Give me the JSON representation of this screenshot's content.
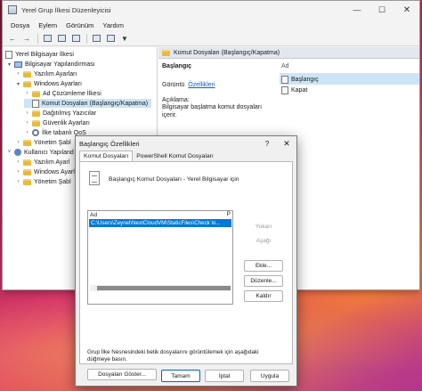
{
  "window": {
    "title": "Yerel Grup İlkesi Düzenleyicisi",
    "controls": {
      "minimize": "—",
      "maximize": "☐",
      "close": "✕"
    }
  },
  "menu": [
    "Dosya",
    "Eylem",
    "Görünüm",
    "Yardım"
  ],
  "toolbar": {
    "buttons": [
      "back",
      "forward",
      "up",
      "show-hide-tree",
      "export",
      "properties",
      "help",
      "filter"
    ],
    "back_glyph": "←",
    "forward_glyph": "→",
    "filter_glyph": "▼"
  },
  "tree": {
    "expanders": {
      "collapse": "▾",
      "expand": "›",
      "collapse_side": "˅"
    },
    "items": [
      {
        "label": "Yerel Bilgisayar İlkesi"
      },
      {
        "label": "Bilgisayar Yapılandırması"
      },
      {
        "label": "Yazılım Ayarları"
      },
      {
        "label": "Windows Ayarları"
      },
      {
        "label": "Ad Çözümleme İlkesi"
      },
      {
        "label": "Komut Dosyaları (Başlangıç/Kapatma)"
      },
      {
        "label": "Dağıtılmış Yazıcılar"
      },
      {
        "label": "Güvenlik Ayarları"
      },
      {
        "label": "İlke tabanlı QoS"
      },
      {
        "label": "Yönetim Şabl"
      },
      {
        "label": "Kullanıcı Yapıland"
      },
      {
        "label": "Yazılım Ayarl"
      },
      {
        "label": "Windows Ayarl"
      },
      {
        "label": "Yönetim Şabl"
      }
    ]
  },
  "right_pane": {
    "header": "Komut Dosyaları (Başlangıç/Kapatma)",
    "section_title": "Başlangıç",
    "show_label": "Görüntü",
    "properties_link": "Özellikleri",
    "description_label": "Açıklama:",
    "description": "Bilgisayar başlatma komut dosyaları içerir.",
    "list_header": "Ad",
    "list_items": [
      "Başlangıç",
      "Kapat"
    ]
  },
  "dialog": {
    "title": "Başlangıç Özellikleri",
    "help": "?",
    "close": "✕",
    "tabs": [
      "Komut Dosyaları",
      "PowerShell Komut Dosyaları"
    ],
    "heading": "Başlangıç Komut Dosyaları - Yerel Bilgisayar için",
    "list_col_name": "Ad",
    "list_col_param": "P",
    "list_rows": [
      "C:\\Users\\Zeynel\\NextCloudVM\\StaticFiles\\Check lo..."
    ],
    "side_buttons": [
      "Yukarı",
      "Aşağı",
      "Ekle...",
      "Düzenle...",
      "Kaldır"
    ],
    "note": "Grup İlke Nesnesindeki betik dosyalarını görüntülemek için aşağıdaki düğmeye basın.",
    "show_files_button": "Dosyaları Göster...",
    "footer_buttons": [
      "Tamam",
      "İptal",
      "Uygula"
    ]
  }
}
